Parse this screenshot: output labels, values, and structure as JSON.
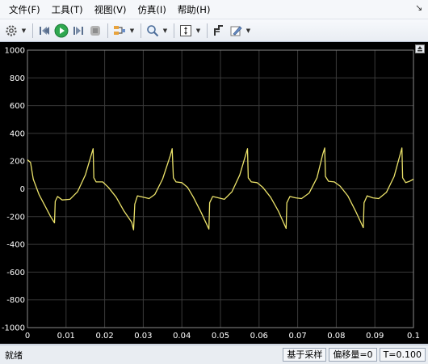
{
  "menu": {
    "items": [
      "文件(F)",
      "工具(T)",
      "视图(V)",
      "仿真(I)",
      "帮助(H)"
    ]
  },
  "toolbar": {
    "icons": [
      "gear-icon",
      "step-back-icon",
      "run-icon",
      "step-forward-icon",
      "stop-icon",
      "highlight-icon",
      "zoom-icon",
      "fit-axes-icon",
      "cursor-measure-icon",
      "style-icon"
    ]
  },
  "colors": {
    "signal": "#ebe26a",
    "grid": "#3a3a3a",
    "axis_text": "#ffffff",
    "run_button": "#2fa84f"
  },
  "chart_data": {
    "type": "line",
    "title": "",
    "xlabel": "",
    "ylabel": "",
    "xlim": [
      0,
      0.1
    ],
    "ylim": [
      -1000,
      1000
    ],
    "grid": true,
    "x_ticks": [
      0,
      0.01,
      0.02,
      0.03,
      0.04,
      0.05,
      0.06,
      0.07,
      0.08,
      0.09,
      0.1
    ],
    "x_tick_labels": [
      "0",
      "0.01",
      "0.02",
      "0.03",
      "0.04",
      "0.05",
      "0.06",
      "0.07",
      "0.08",
      "0.09",
      "0.1"
    ],
    "y_ticks": [
      1000,
      800,
      600,
      400,
      200,
      0,
      -200,
      -400,
      -600,
      -800,
      -1000
    ],
    "y_tick_labels": [
      "1000",
      "800",
      "600",
      "400",
      "200",
      "0",
      "-200",
      "-400",
      "-600",
      "-800",
      "-1000"
    ],
    "series": [
      {
        "values": [
          [
            0,
            210
          ],
          [
            0.0008,
            190
          ],
          [
            0.0015,
            70
          ],
          [
            0.003,
            -40
          ],
          [
            0.0045,
            -120
          ],
          [
            0.006,
            -200
          ],
          [
            0.007,
            -245
          ],
          [
            0.0072,
            -90
          ],
          [
            0.0078,
            -55
          ],
          [
            0.009,
            -80
          ],
          [
            0.011,
            -75
          ],
          [
            0.013,
            -20
          ],
          [
            0.015,
            100
          ],
          [
            0.017,
            290
          ],
          [
            0.0172,
            80
          ],
          [
            0.0178,
            50
          ],
          [
            0.0195,
            50
          ],
          [
            0.021,
            10
          ],
          [
            0.023,
            -60
          ],
          [
            0.025,
            -160
          ],
          [
            0.027,
            -240
          ],
          [
            0.0275,
            -295
          ],
          [
            0.0278,
            -110
          ],
          [
            0.0285,
            -50
          ],
          [
            0.03,
            -60
          ],
          [
            0.0315,
            -70
          ],
          [
            0.033,
            -40
          ],
          [
            0.035,
            70
          ],
          [
            0.037,
            240
          ],
          [
            0.0375,
            290
          ],
          [
            0.0378,
            80
          ],
          [
            0.0385,
            50
          ],
          [
            0.04,
            45
          ],
          [
            0.0415,
            10
          ],
          [
            0.043,
            -60
          ],
          [
            0.045,
            -170
          ],
          [
            0.047,
            -290
          ],
          [
            0.0472,
            -100
          ],
          [
            0.048,
            -55
          ],
          [
            0.0495,
            -65
          ],
          [
            0.051,
            -75
          ],
          [
            0.053,
            -20
          ],
          [
            0.055,
            100
          ],
          [
            0.057,
            290
          ],
          [
            0.0572,
            80
          ],
          [
            0.058,
            50
          ],
          [
            0.0595,
            45
          ],
          [
            0.061,
            10
          ],
          [
            0.063,
            -60
          ],
          [
            0.065,
            -160
          ],
          [
            0.067,
            -285
          ],
          [
            0.0672,
            -100
          ],
          [
            0.068,
            -55
          ],
          [
            0.0695,
            -65
          ],
          [
            0.071,
            -70
          ],
          [
            0.073,
            -30
          ],
          [
            0.075,
            80
          ],
          [
            0.0765,
            250
          ],
          [
            0.077,
            295
          ],
          [
            0.0772,
            90
          ],
          [
            0.078,
            55
          ],
          [
            0.0795,
            50
          ],
          [
            0.081,
            20
          ],
          [
            0.083,
            -50
          ],
          [
            0.085,
            -160
          ],
          [
            0.087,
            -280
          ],
          [
            0.0872,
            -100
          ],
          [
            0.088,
            -50
          ],
          [
            0.0895,
            -65
          ],
          [
            0.091,
            -70
          ],
          [
            0.093,
            -25
          ],
          [
            0.095,
            90
          ],
          [
            0.097,
            295
          ],
          [
            0.0972,
            80
          ],
          [
            0.098,
            45
          ],
          [
            0.099,
            55
          ],
          [
            0.1,
            70
          ]
        ]
      }
    ]
  },
  "status": {
    "ready": "就绪",
    "sampling": "基于采样",
    "offset": "偏移量=0",
    "time": "T=0.100"
  }
}
